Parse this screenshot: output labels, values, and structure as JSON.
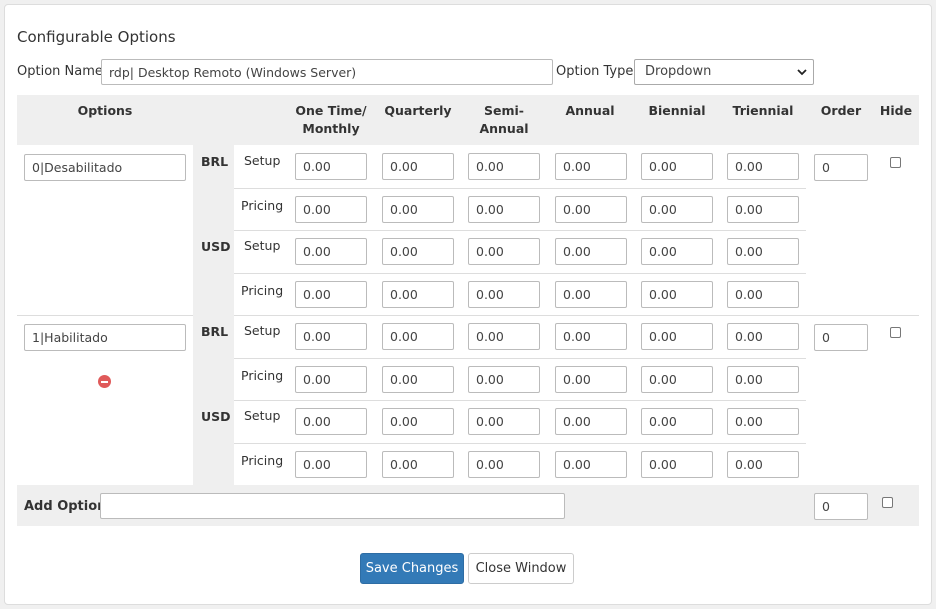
{
  "section_title": "Configurable Options",
  "option_name_label": "Option Name:",
  "option_name_value": "rdp| Desktop Remoto (Windows Server)",
  "option_type_label": "Option Type:",
  "option_type_value": "Dropdown",
  "headers": {
    "options": "Options",
    "cycles": [
      "One Time/\nMonthly",
      "Quarterly",
      "Semi-\nAnnual",
      "Annual",
      "Biennial",
      "Triennial"
    ],
    "order": "Order",
    "hide": "Hide"
  },
  "row_labels": {
    "setup": "Setup",
    "pricing": "Pricing"
  },
  "options": [
    {
      "name": "0|Desabilitado",
      "order": "0",
      "hidden": false,
      "removable": false,
      "currencies": [
        {
          "code": "BRL",
          "setup": [
            "0.00",
            "0.00",
            "0.00",
            "0.00",
            "0.00",
            "0.00"
          ],
          "pricing": [
            "0.00",
            "0.00",
            "0.00",
            "0.00",
            "0.00",
            "0.00"
          ]
        },
        {
          "code": "USD",
          "setup": [
            "0.00",
            "0.00",
            "0.00",
            "0.00",
            "0.00",
            "0.00"
          ],
          "pricing": [
            "0.00",
            "0.00",
            "0.00",
            "0.00",
            "0.00",
            "0.00"
          ]
        }
      ]
    },
    {
      "name": "1|Habilitado",
      "order": "0",
      "hidden": false,
      "removable": true,
      "currencies": [
        {
          "code": "BRL",
          "setup": [
            "0.00",
            "0.00",
            "0.00",
            "0.00",
            "0.00",
            "0.00"
          ],
          "pricing": [
            "0.00",
            "0.00",
            "0.00",
            "0.00",
            "0.00",
            "0.00"
          ]
        },
        {
          "code": "USD",
          "setup": [
            "0.00",
            "0.00",
            "0.00",
            "0.00",
            "0.00",
            "0.00"
          ],
          "pricing": [
            "0.00",
            "0.00",
            "0.00",
            "0.00",
            "0.00",
            "0.00"
          ]
        }
      ]
    }
  ],
  "add_option": {
    "label": "Add Option:",
    "value": "",
    "order": "0",
    "hidden": false
  },
  "buttons": {
    "save": "Save Changes",
    "close": "Close Window"
  },
  "colors": {
    "primary": "#337ab7",
    "remove": "#e05a5a",
    "header_bg": "#efefef"
  }
}
